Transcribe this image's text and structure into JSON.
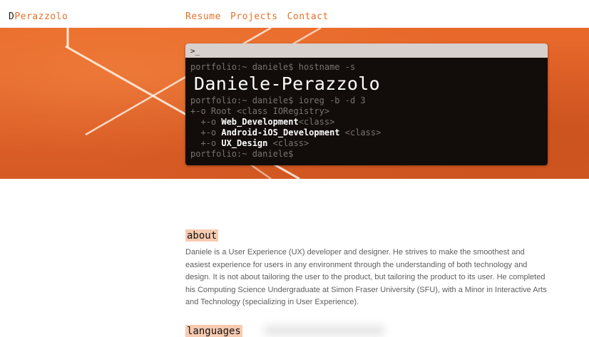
{
  "nav": {
    "brand_initial": "D",
    "brand_rest": "Perazzolo",
    "links": [
      "Resume",
      "Projects",
      "Contact"
    ]
  },
  "terminal": {
    "title": ">_",
    "cmd1": "portfolio:~ daniele$ hostname -s",
    "hostname": "Daniele-Perazzolo",
    "cmd2": "portfolio:~ daniele$ ioreg -b -d 3",
    "root_line": "+-o Root <class IORegistry>",
    "entries": [
      {
        "prefix": "  +-o ",
        "name": "Web_Development",
        "suffix": "<class>"
      },
      {
        "prefix": "  +-o ",
        "name": "Android-iOS_Development",
        "suffix": " <class>"
      },
      {
        "prefix": "  +-o ",
        "name": "UX_Design",
        "suffix": " <class>"
      }
    ],
    "prompt": "portfolio:~ daniele$"
  },
  "about": {
    "heading": "about",
    "text": "Daniele is a User Experience (UX) developer and designer. He strives to make the smoothest and easiest experience for users in any environment through the understanding of both technology and design. It is not about tailoring the user to the product, but tailoring the product to its user. He completed his Computing Science Undergraduate at Simon Fraser University (SFU), with a Minor in Interactive Arts and Technology (specializing in User Experience)."
  },
  "languages": {
    "heading": "languages"
  },
  "colors": {
    "accent": "#e8702a",
    "highlight": "#f7cbb1",
    "terminal_bg": "#120c0a"
  }
}
